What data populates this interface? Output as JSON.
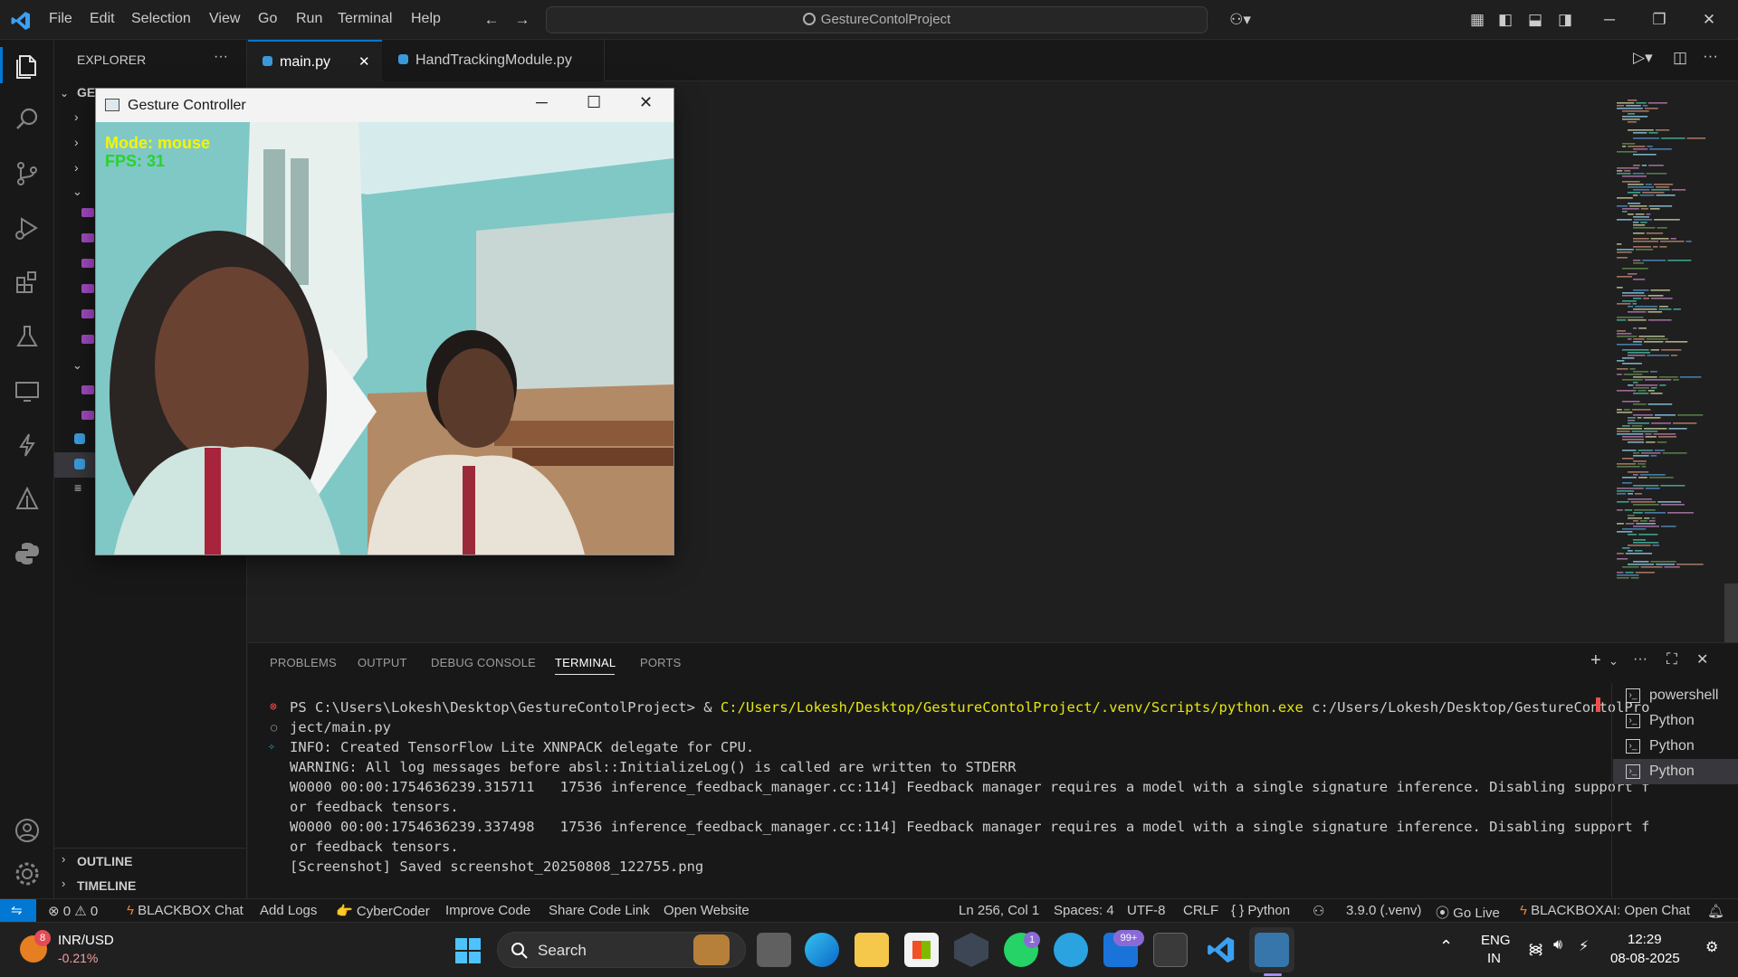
{
  "menu": [
    "File",
    "Edit",
    "Selection",
    "View",
    "Go",
    "Run",
    "Terminal",
    "Help"
  ],
  "search": {
    "label": "GestureContolProject"
  },
  "sidebar": {
    "title": "EXPLORER",
    "more": "···",
    "root_label": "GES",
    "outline": "OUTLINE",
    "timeline": "TIMELINE"
  },
  "tabs": [
    {
      "label": "main.py",
      "active": true,
      "close": "✕"
    },
    {
      "label": "HandTrackingModule.py",
      "active": false
    }
  ],
  "gesture_window": {
    "title": "Gesture Controller",
    "overlay_mode": "Mode: mouse",
    "overlay_fps": "FPS: 31"
  },
  "panel": {
    "tabs": [
      "PROBLEMS",
      "OUTPUT",
      "DEBUG CONSOLE",
      "TERMINAL",
      "PORTS"
    ],
    "active_tab": "TERMINAL",
    "terminal_lines": [
      {
        "marker": "error",
        "prefix": "PS C:\\Users\\Lokesh\\Desktop\\GestureContolProject> & ",
        "path": "C:/Users/Lokesh/Desktop/GestureContolProject/.venv/Scripts/python.exe",
        "suffix": " c:/Users/Lokesh/Desktop/GestureContolPro"
      },
      {
        "marker": "circle",
        "text": "ject/main.py"
      },
      {
        "marker": "sparkle",
        "text": "INFO: Created TensorFlow Lite XNNPACK delegate for CPU."
      },
      {
        "marker": "",
        "text": "WARNING: All log messages before absl::InitializeLog() is called are written to STDERR"
      },
      {
        "marker": "",
        "text": "W0000 00:00:1754636239.315711   17536 inference_feedback_manager.cc:114] Feedback manager requires a model with a single signature inference. Disabling support f"
      },
      {
        "marker": "",
        "text": "or feedback tensors."
      },
      {
        "marker": "",
        "text": "W0000 00:00:1754636239.337498   17536 inference_feedback_manager.cc:114] Feedback manager requires a model with a single signature inference. Disabling support f"
      },
      {
        "marker": "",
        "text": "or feedback tensors."
      },
      {
        "marker": "",
        "text": "[Screenshot] Saved screenshot_20250808_122755.png"
      }
    ],
    "terminal_list": [
      "powershell",
      "Python",
      "Python",
      "Python"
    ]
  },
  "status": {
    "errors": "0",
    "warnings": "0",
    "left_items": [
      "BLACKBOX Chat",
      "Add Logs",
      "CyberCoder",
      "Improve Code",
      "Share Code Link",
      "Open Website"
    ],
    "position": "Ln 256, Col 1",
    "spaces": "Spaces: 4",
    "encoding": "UTF-8",
    "eol": "CRLF",
    "language": "Python",
    "interpreter": "3.9.0 (.venv)",
    "golive": "Go Live",
    "blackbox_ai": "BLACKBOXAI: Open Chat"
  },
  "taskbar": {
    "ticker_badge": "8",
    "ticker_name": "INR/USD",
    "ticker_change": "-0.21%",
    "search": "Search",
    "whatsapp_badge": "1",
    "outlook_badge": "99+",
    "lang1": "ENG",
    "lang2": "IN",
    "time": "12:29",
    "date": "08-08-2025"
  },
  "colors": {
    "accent": "#0078d4",
    "yellow_path": "#e5e510",
    "error": "#f14c4c",
    "overlay_text": "#f5f500"
  }
}
